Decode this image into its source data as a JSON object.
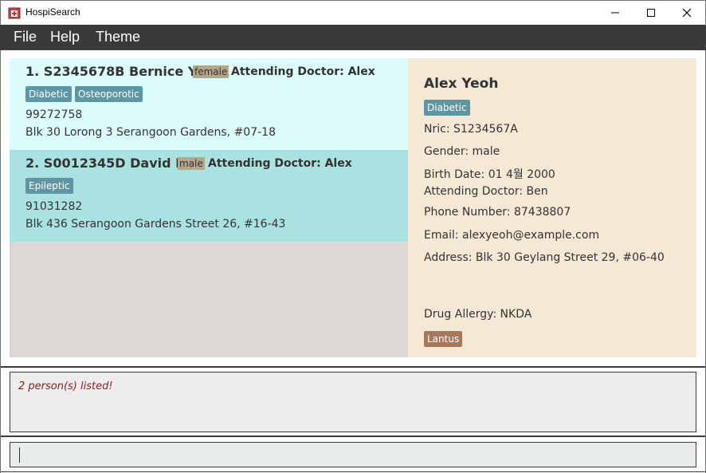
{
  "window": {
    "title": "HospiSearch",
    "icons": {
      "app": "hospital-icon",
      "minimize": "minimize-icon",
      "maximize": "maximize-icon",
      "close": "close-icon"
    }
  },
  "menu": {
    "items": [
      {
        "label": "File"
      },
      {
        "label": "Help"
      },
      {
        "label": "Theme"
      }
    ]
  },
  "patients": [
    {
      "index": "1.",
      "nric": "S2345678B",
      "name": "Bernice Yu",
      "gender": "female",
      "attending": "Attending Doctor: Alex",
      "tags": [
        "Diabetic",
        "Osteoporotic"
      ],
      "phone": "99272758",
      "address": "Blk 30 Lorong 3 Serangoon Gardens, #07-18"
    },
    {
      "index": "2.",
      "nric": "S0012345D",
      "name": "David Li",
      "gender": "male",
      "attending": "Attending Doctor: Alex",
      "tags": [
        "Epileptic"
      ],
      "phone": "91031282",
      "address": "Blk 436 Serangoon Gardens Street 26, #16-43"
    }
  ],
  "detail": {
    "name": "Alex Yeoh",
    "tag": "Diabetic",
    "nric": "Nric: S1234567A",
    "gender": "Gender: male",
    "birth_date": "Birth Date: 01 4월 2000",
    "attending": "Attending Doctor: Ben",
    "phone": "Phone Number: 87438807",
    "email": "Email: alexyeoh@example.com",
    "address": "Address: Blk 30 Geylang Street 29, #06-40",
    "drug_allergy": "Drug Allergy: NKDA",
    "medication_tag": "Lantus"
  },
  "result": {
    "message": "2 person(s) listed!"
  },
  "command": {
    "value": ""
  },
  "colors": {
    "menubar": "#3a3a3a",
    "card_selected": "#dcfcfb",
    "card_alt": "#a9e2e1",
    "detail_bg": "#f5e9d5",
    "tag_blue": "#5e97a3",
    "tag_brown": "#a8775c",
    "gender_badge": "#b4a68a",
    "result_text": "#8a2020"
  }
}
